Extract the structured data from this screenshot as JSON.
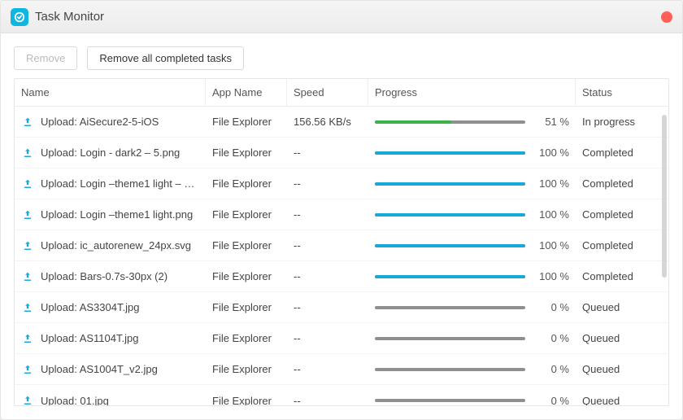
{
  "window": {
    "title": "Task Monitor"
  },
  "toolbar": {
    "remove_label": "Remove",
    "remove_all_label": "Remove all completed tasks"
  },
  "columns": {
    "name": "Name",
    "app": "App Name",
    "speed": "Speed",
    "progress": "Progress",
    "status": "Status"
  },
  "rows": [
    {
      "name": "Upload: AiSecure2-5-iOS",
      "app": "File Explorer",
      "speed": "156.56 KB/s",
      "pct": "51 %",
      "status": "In progress",
      "fill": 51,
      "color": "green"
    },
    {
      "name": "Upload: Login - dark2 – 5.png",
      "app": "File Explorer",
      "speed": "--",
      "pct": "100 %",
      "status": "Completed",
      "fill": 100,
      "color": "blue"
    },
    {
      "name": "Upload: Login –theme1 light – 1....",
      "app": "File Explorer",
      "speed": "--",
      "pct": "100 %",
      "status": "Completed",
      "fill": 100,
      "color": "blue"
    },
    {
      "name": "Upload: Login –theme1 light.png",
      "app": "File Explorer",
      "speed": "--",
      "pct": "100 %",
      "status": "Completed",
      "fill": 100,
      "color": "blue"
    },
    {
      "name": "Upload: ic_autorenew_24px.svg",
      "app": "File Explorer",
      "speed": "--",
      "pct": "100 %",
      "status": "Completed",
      "fill": 100,
      "color": "blue"
    },
    {
      "name": "Upload: Bars-0.7s-30px (2)",
      "app": "File Explorer",
      "speed": "--",
      "pct": "100 %",
      "status": "Completed",
      "fill": 100,
      "color": "blue"
    },
    {
      "name": "Upload: AS3304T.jpg",
      "app": "File Explorer",
      "speed": "--",
      "pct": "0 %",
      "status": "Queued",
      "fill": 0,
      "color": "grey"
    },
    {
      "name": "Upload: AS1104T.jpg",
      "app": "File Explorer",
      "speed": "--",
      "pct": "0 %",
      "status": "Queued",
      "fill": 0,
      "color": "grey"
    },
    {
      "name": "Upload: AS1004T_v2.jpg",
      "app": "File Explorer",
      "speed": "--",
      "pct": "0 %",
      "status": "Queued",
      "fill": 0,
      "color": "grey"
    },
    {
      "name": "Upload: 01.jpg",
      "app": "File Explorer",
      "speed": "--",
      "pct": "0 %",
      "status": "Queued",
      "fill": 0,
      "color": "grey"
    }
  ]
}
